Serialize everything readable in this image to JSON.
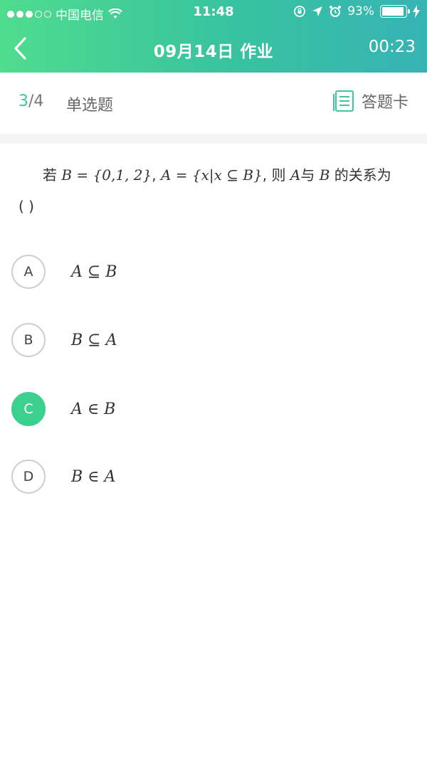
{
  "status_bar": {
    "carrier": "中国电信",
    "time": "11:48",
    "battery_percent": "93%",
    "battery_level": 0.93
  },
  "nav": {
    "title": "09月14日 作业",
    "timer": "00:23"
  },
  "info": {
    "current": "3",
    "total": "/4",
    "question_type": "单选题",
    "answer_card_label": "答题卡"
  },
  "question": {
    "prefix": "若",
    "set_b": "B = {0,1, 2}",
    "sep1": ",",
    "set_a": "A = {x|x ⊆ B}",
    "middle": ", 则",
    "a": "A",
    "and": "与",
    "b": "B",
    "suffix": "的关系为",
    "blank": "(    )"
  },
  "options": [
    {
      "letter": "A",
      "text": "A ⊆ B",
      "selected": false
    },
    {
      "letter": "B",
      "text": "B ⊆ A",
      "selected": false
    },
    {
      "letter": "C",
      "text": "A ∈ B",
      "selected": true
    },
    {
      "letter": "D",
      "text": "B ∈ A",
      "selected": false
    }
  ],
  "colors": {
    "header_gradient_start": "#4fdc8e",
    "header_gradient_end": "#36b4b5",
    "accent": "#3ec79a",
    "selected_option": "#3cd08e"
  }
}
